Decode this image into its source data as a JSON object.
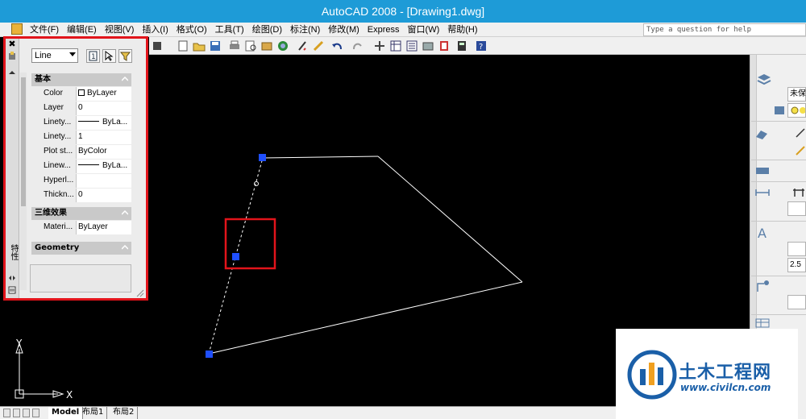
{
  "window": {
    "title": "AutoCAD 2008 - [Drawing1.dwg]"
  },
  "menu": {
    "items": [
      "文件(F)",
      "编辑(E)",
      "视图(V)",
      "插入(I)",
      "格式(O)",
      "工具(T)",
      "绘图(D)",
      "标注(N)",
      "修改(M)",
      "Express",
      "窗口(W)",
      "帮助(H)"
    ],
    "help_placeholder": "Type a question for help"
  },
  "properties": {
    "object_type": "Line",
    "side_label": "特性",
    "section_basic": "基本",
    "section_3d": "三维效果",
    "section_geometry": "Geometry",
    "rows_basic": [
      {
        "name": "Color",
        "value": "ByLayer",
        "kind": "swatch"
      },
      {
        "name": "Layer",
        "value": "0",
        "kind": "text"
      },
      {
        "name": "Linety...",
        "value": "ByLa...",
        "kind": "dash"
      },
      {
        "name": "Linety...",
        "value": "1",
        "kind": "text"
      },
      {
        "name": "Plot st...",
        "value": "ByColor",
        "kind": "text"
      },
      {
        "name": "Linew...",
        "value": "ByLa...",
        "kind": "dash"
      },
      {
        "name": "Hyperl...",
        "value": "",
        "kind": "text"
      },
      {
        "name": "Thickn...",
        "value": "0",
        "kind": "text"
      }
    ],
    "rows_3d": [
      {
        "name": "Materi...",
        "value": "ByLayer",
        "kind": "text"
      }
    ]
  },
  "right_panel": {
    "layer_value": "未保",
    "dim_value": "2.5"
  },
  "layout_tabs": [
    "Model",
    "布局1",
    "布局2"
  ],
  "ucs": {
    "x_label": "X",
    "y_label": "Y"
  },
  "watermark": {
    "name": "土木工程网",
    "url": "www.civilcn.com"
  },
  "colors": {
    "titlebar": "#1e9bd7",
    "canvas": "#000000",
    "highlight_box": "#e2141b",
    "grip": "#1f4fff",
    "line": "#ffffff"
  }
}
